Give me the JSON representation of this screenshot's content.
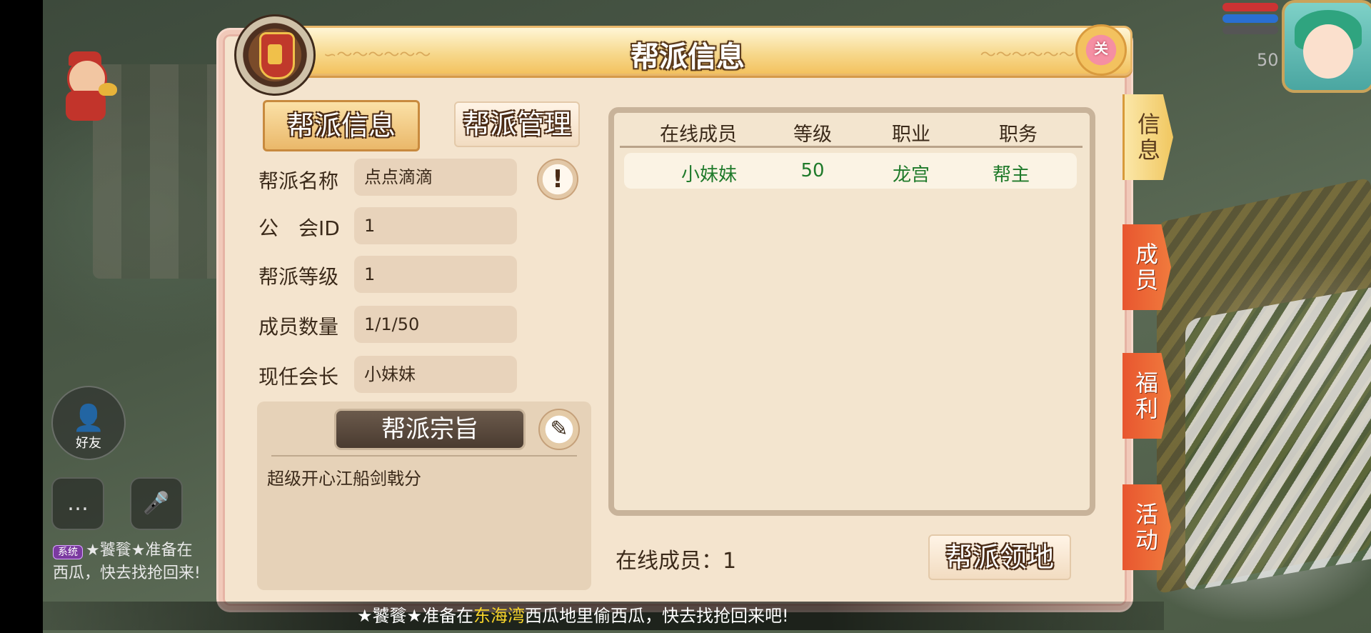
{
  "panel": {
    "title": "帮派信息",
    "close_label": "关"
  },
  "tabs": {
    "info": "帮派信息",
    "manage": "帮派管理"
  },
  "info_rows": [
    {
      "label": "帮派名称",
      "value": "点点滴滴"
    },
    {
      "label": "公　会ID",
      "value": "1"
    },
    {
      "label": "帮派等级",
      "value": "1"
    },
    {
      "label": "成员数量",
      "value": "1/1/50"
    },
    {
      "label": "现任会长",
      "value": "小妹妹"
    }
  ],
  "purpose": {
    "title": "帮派宗旨",
    "text": "超级开心江船剑戟分"
  },
  "members_table": {
    "headers": [
      "在线成员",
      "等级",
      "职业",
      "职务"
    ],
    "rows": [
      {
        "name": "小妹妹",
        "level": "50",
        "class": "龙宫",
        "role": "帮主"
      }
    ]
  },
  "online_count": "在线成员：1",
  "territory_button": "帮派领地",
  "side_tabs": [
    {
      "line1": "信",
      "line2": "息",
      "active": true
    },
    {
      "line1": "成",
      "line2": "员",
      "active": false
    },
    {
      "line1": "福",
      "line2": "利",
      "active": false
    },
    {
      "line1": "活",
      "line2": "动",
      "active": false
    }
  ],
  "hud": {
    "friend_label": "好友",
    "player_level": "50",
    "chat_tag": "系统",
    "chat_line1": "★饕餮★准备在",
    "chat_line2": "西瓜，快去找抢回来!"
  },
  "broadcast": {
    "prefix": "★饕餮★准备在",
    "highlight": "东海湾",
    "suffix": "西瓜地里偷西瓜，快去找抢回来吧!"
  },
  "colors": {
    "accent_gold": "#f3c25f",
    "member_green": "#1f7a2a",
    "tab_orange": "#e8562f"
  },
  "icons": [
    "alert-icon",
    "edit-icon",
    "chat-icon",
    "mic-icon",
    "friend-icon"
  ]
}
